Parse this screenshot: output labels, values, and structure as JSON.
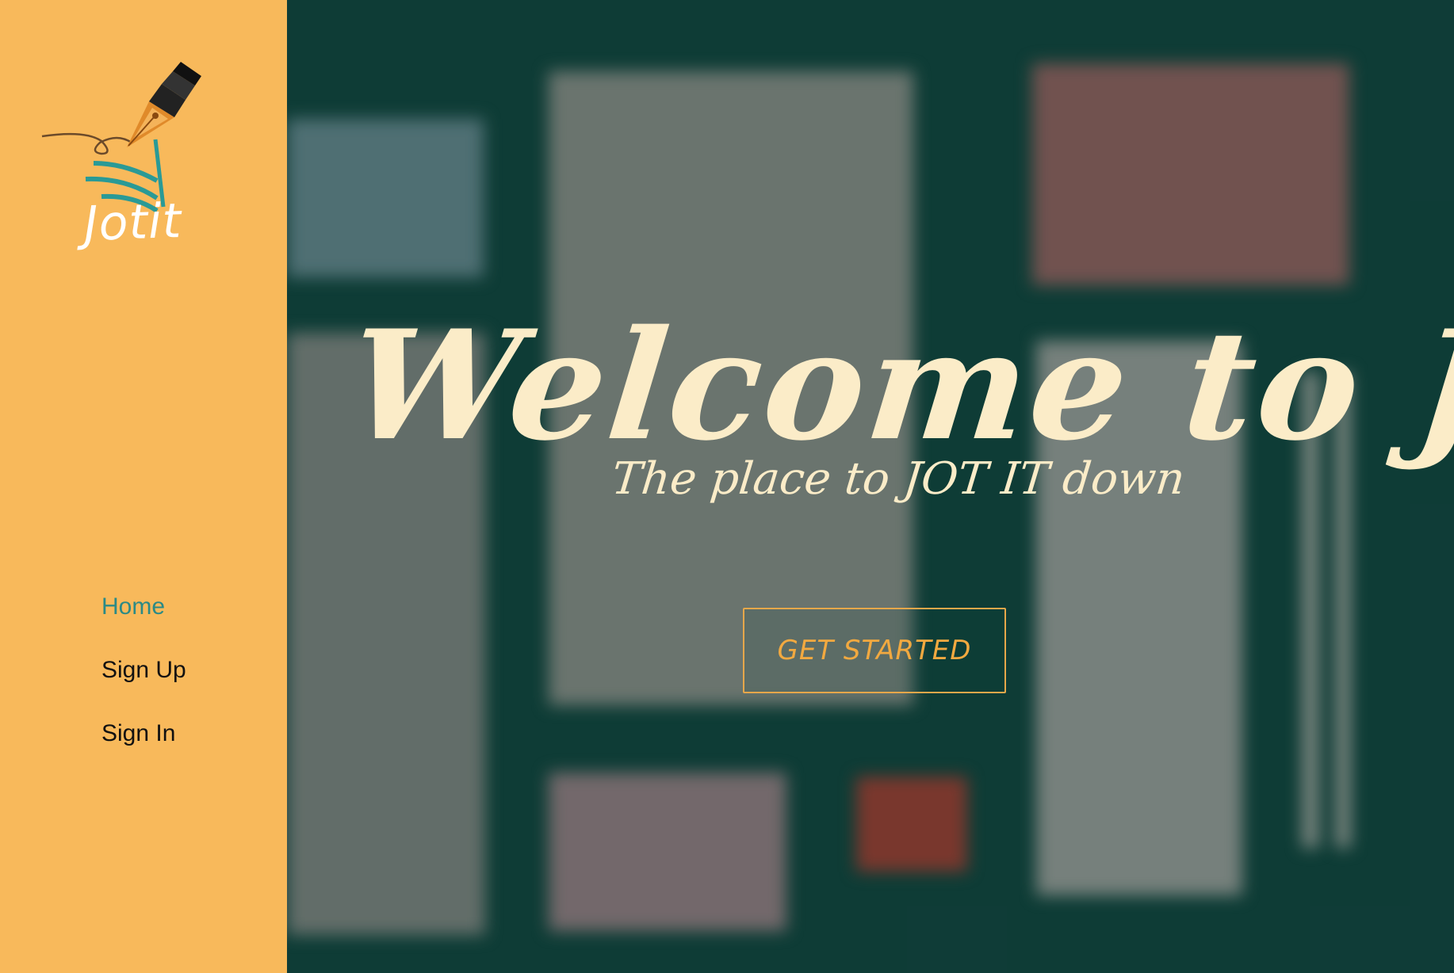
{
  "app": {
    "name": "Jotit"
  },
  "sidebar": {
    "logo_text": "Jotit",
    "nav": [
      {
        "label": "Home",
        "active": true
      },
      {
        "label": "Sign Up",
        "active": false
      },
      {
        "label": "Sign In",
        "active": false
      }
    ]
  },
  "hero": {
    "title": "Welcome to Jotit",
    "subtitle": "The place to JOT IT down",
    "cta_label": "GET STARTED"
  },
  "colors": {
    "sidebar_bg": "#f8b95b",
    "nav_active": "#2b8a86",
    "hero_text": "#fbecc8",
    "cta_accent": "#f2a940",
    "hero_bg": "#10403a"
  },
  "icons": {
    "logo": "fountain-pen-book-logo"
  }
}
